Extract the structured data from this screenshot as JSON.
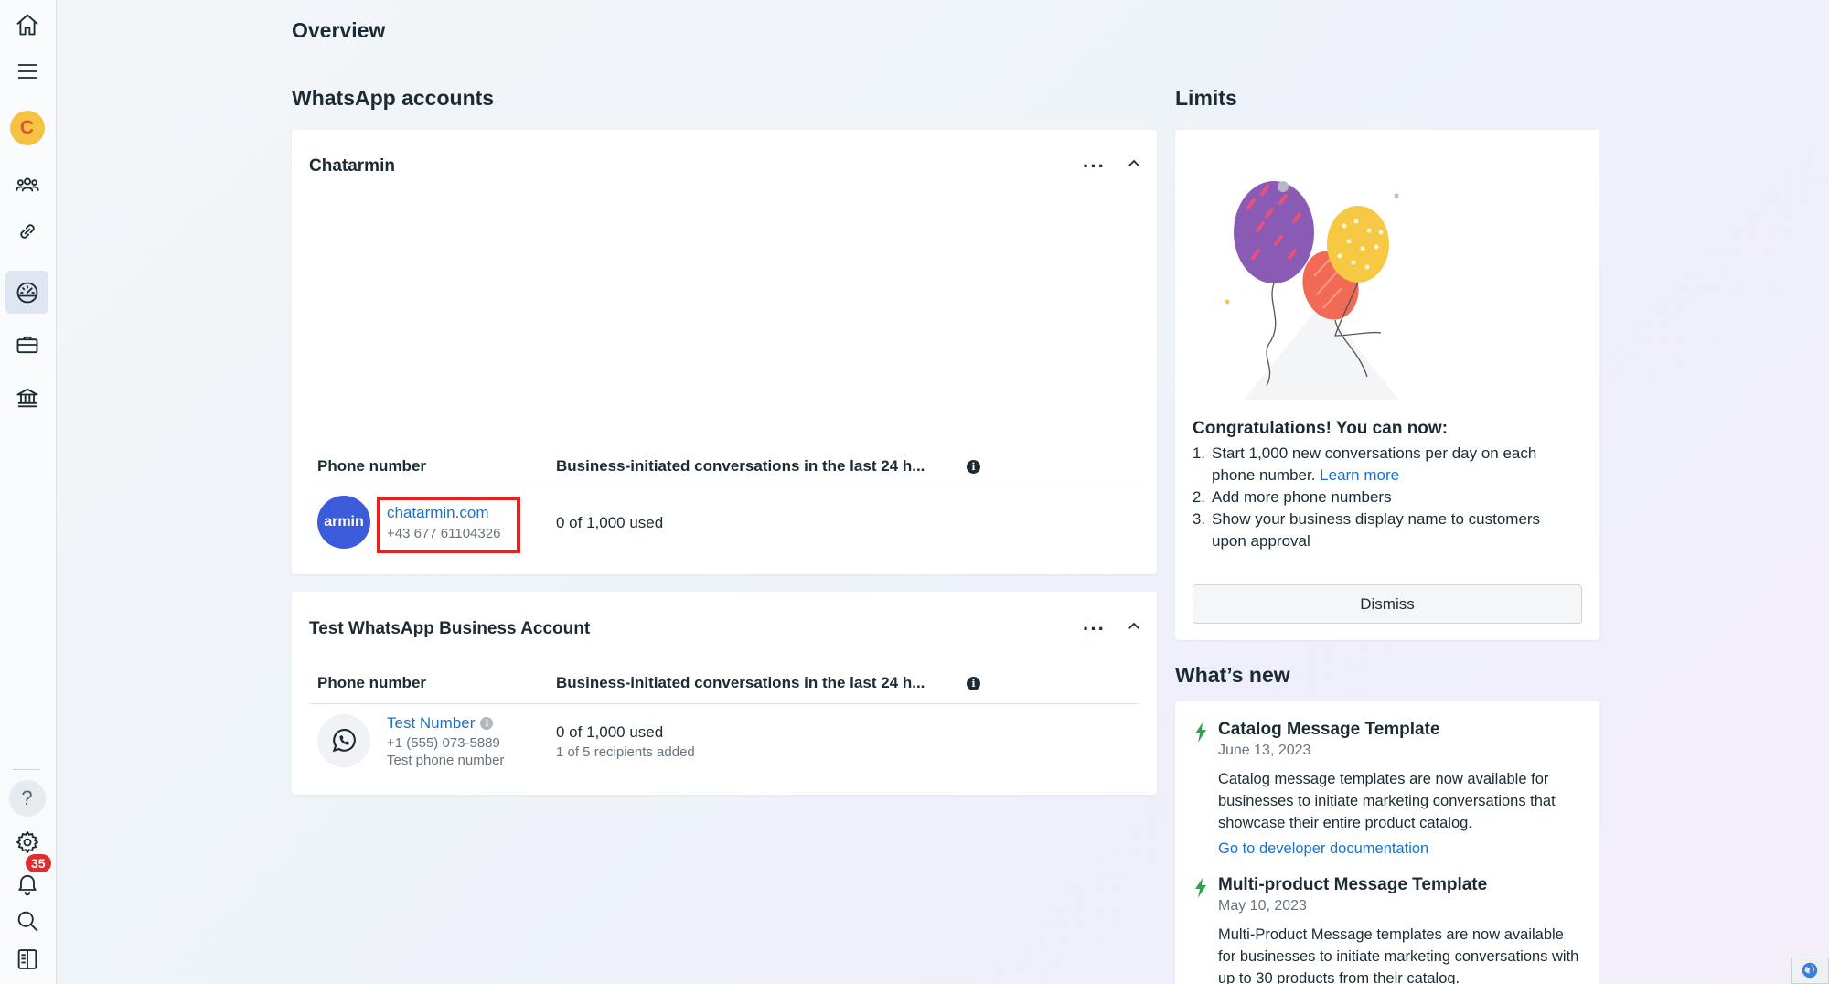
{
  "page": {
    "title": "Overview"
  },
  "sidebar": {
    "avatar_letter": "C",
    "notification_count": "35",
    "help_glyph": "?"
  },
  "accounts": {
    "section_title": "WhatsApp accounts",
    "cards": [
      {
        "name": "Chatarmin",
        "menu_glyph": "···",
        "col_phone": "Phone number",
        "col_conversations": "Business-initiated conversations in the last 24 h...",
        "info_glyph": "i",
        "rows": [
          {
            "avatar_text": "armin",
            "display_name": "chatarmin.com",
            "phone": "+43 677 61104326",
            "usage": "0 of 1,000 used"
          }
        ]
      },
      {
        "name": "Test WhatsApp Business Account",
        "menu_glyph": "···",
        "col_phone": "Phone number",
        "col_conversations": "Business-initiated conversations in the last 24 h...",
        "info_glyph": "i",
        "rows": [
          {
            "display_name": "Test Number",
            "phone": "+1 (555) 073-5889",
            "note": "Test phone number",
            "usage": "0 of 1,000 used",
            "recipients": "1 of 5 recipients added"
          }
        ]
      }
    ]
  },
  "limits": {
    "section_title": "Limits",
    "heading": "Congratulations! You can now:",
    "items": [
      {
        "num": "1.",
        "text": "Start 1,000 new conversations per day on each phone number.",
        "link": "Learn more"
      },
      {
        "num": "2.",
        "text": "Add more phone numbers"
      },
      {
        "num": "3.",
        "text": "Show your business display name to customers upon approval"
      }
    ],
    "dismiss_label": "Dismiss"
  },
  "whats_new": {
    "section_title": "What’s new",
    "items": [
      {
        "title": "Catalog Message Template",
        "date": "June 13, 2023",
        "body": "Catalog message templates are now available for businesses to initiate marketing conversations that showcase their entire product catalog.",
        "link": "Go to developer documentation"
      },
      {
        "title": "Multi-product Message Template",
        "date": "May 10, 2023",
        "body": "Multi-Product Message templates are now available for businesses to initiate marketing conversations with up to 30 products from their catalog."
      }
    ]
  },
  "colors": {
    "accent": "#1a73c9",
    "avatar_blue": "#3b5bdb",
    "highlight_red": "#e8211b",
    "bolt_green": "#31a24c",
    "badge_red": "#e02d2d"
  }
}
